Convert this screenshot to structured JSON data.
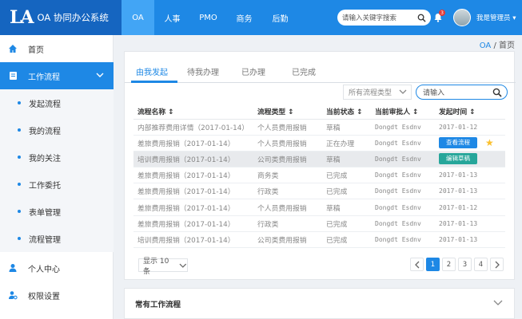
{
  "brand": {
    "logo": "LA",
    "title": "OA 协同办公系统"
  },
  "nav": [
    "OA",
    "人事",
    "PMO",
    "商务",
    "后勤"
  ],
  "search": {
    "placeholder": "请输入关键字搜索"
  },
  "notifications": {
    "count": "3"
  },
  "user": {
    "name": "我是管理员"
  },
  "sidebar": {
    "home": "首页",
    "workflow": "工作流程",
    "sub": [
      "发起流程",
      "我的流程",
      "我的关注",
      "工作委托",
      "表单管理",
      "流程管理"
    ],
    "personal": "个人中心",
    "permissions": "权限设置"
  },
  "breadcrumb": {
    "root": "OA",
    "sep": "/",
    "current": "首页"
  },
  "tabs": [
    "由我发起",
    "待我办理",
    "已办理",
    "已完成"
  ],
  "filter": {
    "type_select": "所有流程类型",
    "input_placeholder": "请输入"
  },
  "table": {
    "headers": [
      "流程名称",
      "流程类型",
      "当前状态",
      "当前审批人",
      "发起时间"
    ],
    "rows": [
      {
        "name": "内部推荐费用详情（2017-01-14）",
        "type": "个人员费用报销",
        "status": "草稿",
        "approver": "Dongdt Esdnv",
        "date": "2017-01-12",
        "action": ""
      },
      {
        "name": "差旅费用报销（2017-01-14）",
        "type": "个人员费用报销",
        "status": "正在办理",
        "approver": "Dongdt Esdnv",
        "date": "",
        "action": "查看流程"
      },
      {
        "name": "培训费用报销（2017-01-14）",
        "type": "公司类费用报销",
        "status": "草稿",
        "approver": "Dongdt Esdnv",
        "date": "",
        "action": "编辑草稿"
      },
      {
        "name": "差旅费用报销（2017-01-14）",
        "type": "商务类",
        "status": "已完成",
        "approver": "Dongdt Esdnv",
        "date": "2017-01-13",
        "action": ""
      },
      {
        "name": "差旅费用报销（2017-01-14）",
        "type": "行政类",
        "status": "已完成",
        "approver": "Dongdt Esdnv",
        "date": "2017-01-13",
        "action": ""
      },
      {
        "name": "差旅费用报销（2017-01-14）",
        "type": "个人员费用报销",
        "status": "草稿",
        "approver": "Dongdt Esdnv",
        "date": "2017-01-12",
        "action": ""
      },
      {
        "name": "差旅费用报销（2017-01-14）",
        "type": "行政类",
        "status": "已完成",
        "approver": "Dongdt Esdnv",
        "date": "2017-01-13",
        "action": ""
      },
      {
        "name": "培训费用报销（2017-01-14）",
        "type": "公司类费用报销",
        "status": "已完成",
        "approver": "Dongdt Esdnv",
        "date": "2017-01-13",
        "action": ""
      }
    ]
  },
  "pagination": {
    "page_size": "显示 10 条",
    "pages": [
      "1",
      "2",
      "3",
      "4"
    ],
    "current": "1"
  },
  "common_workflow": {
    "title": "常有工作流程"
  },
  "colors": {
    "primary": "#1e88e5",
    "brand_dark": "#1565c0",
    "success": "#26a69a",
    "star": "#fbc02d"
  }
}
